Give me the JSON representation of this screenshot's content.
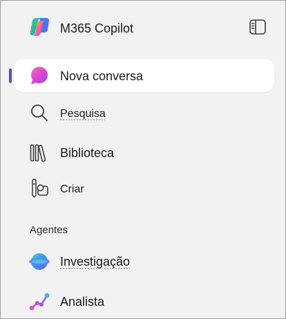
{
  "app": {
    "title": "M365 Copilot"
  },
  "nav": {
    "items": [
      {
        "id": "new-chat",
        "label": "Nova conversa",
        "icon": "copilot-chat-icon",
        "active": true
      },
      {
        "id": "search",
        "label": "Pesquisa",
        "icon": "search-icon",
        "active": false
      },
      {
        "id": "library",
        "label": "Biblioteca",
        "icon": "library-icon",
        "active": false
      },
      {
        "id": "create",
        "label": "Criar",
        "icon": "create-icon",
        "active": false
      }
    ]
  },
  "agents": {
    "heading": "Agentes",
    "items": [
      {
        "id": "researcher",
        "label": "Investigação",
        "icon": "researcher-agent-icon"
      },
      {
        "id": "analyst",
        "label": "Analista",
        "icon": "analyst-agent-icon"
      }
    ]
  },
  "colors": {
    "panel_background": "#f2f2f2",
    "active_item_background": "#ffffff",
    "active_indicator": "#4f52b2",
    "text": "#1b1b1b"
  }
}
